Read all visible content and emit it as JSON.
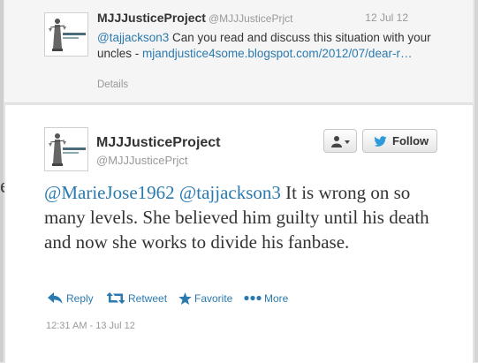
{
  "reply_tweet": {
    "display_name": "MJJJusticeProject",
    "handle": "@MJJJusticePrjct",
    "date": "12 Jul 12",
    "mention": "@tajjackson3",
    "text_body": " Can you read and discuss this situation with your uncles - ",
    "link_text": "mjandjustice4some.blogspot.com/2012/07/dear-r…",
    "details_label": "Details"
  },
  "main_tweet": {
    "display_name": "MJJJusticeProject",
    "handle": "@MJJJusticePrjct",
    "follow_label": "Follow",
    "mention_1": "@MarieJose1962",
    "mention_2": "@tajjackson3",
    "text_body": " It is wrong on so many levels. She believed him guilty until his death and now she works to divide his fanbase.",
    "actions": {
      "reply": "Reply",
      "retweet": "Retweet",
      "favorite": "Favorite",
      "more": "More"
    },
    "timestamp": "12:31 AM - 13 Jul 12"
  },
  "icons": {
    "user_dropdown": "person-icon",
    "follow": "twitter-bird-icon",
    "reply": "reply-arrow-icon",
    "retweet": "retweet-icon",
    "favorite": "star-icon",
    "more": "dots-icon"
  },
  "colors": {
    "link": "#2a7aaf",
    "text": "#333333",
    "muted": "#999999",
    "bird": "#2f9ad9"
  }
}
